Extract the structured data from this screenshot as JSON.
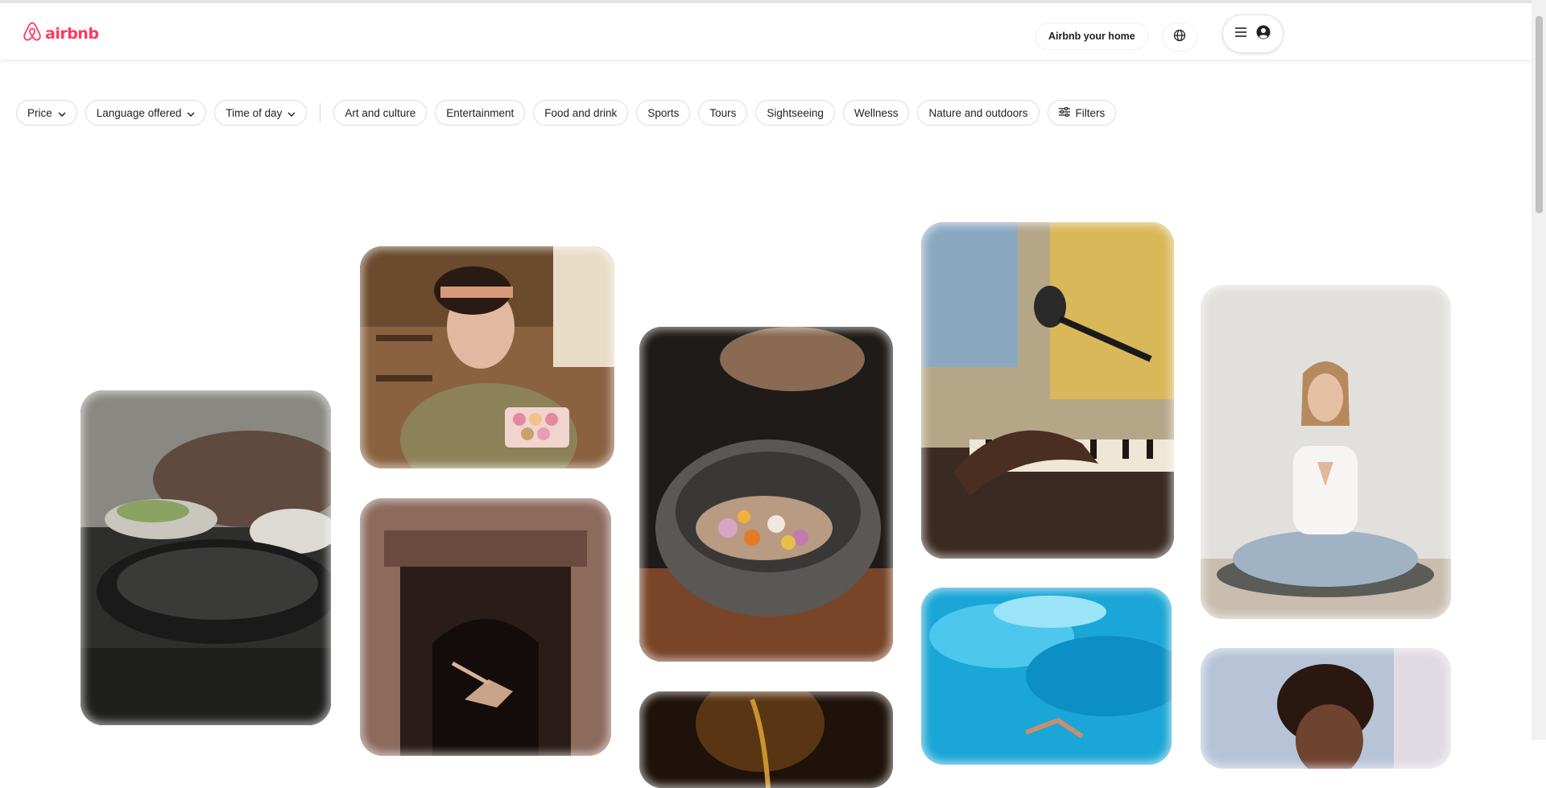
{
  "header": {
    "logo_text": "airbnb",
    "logo_icon": "airbnb-belo-icon",
    "host_label": "Airbnb your home",
    "globe_icon": "globe-icon",
    "menu_icon": "hamburger-menu-icon",
    "user_icon": "user-avatar-icon"
  },
  "filters": {
    "dropdowns": [
      {
        "label": "Price",
        "icon": "chevron-down-icon"
      },
      {
        "label": "Language offered",
        "icon": "chevron-down-icon"
      },
      {
        "label": "Time of day",
        "icon": "chevron-down-icon"
      }
    ],
    "categories": [
      "Art and culture",
      "Entertainment",
      "Food and drink",
      "Sports",
      "Tours",
      "Sightseeing",
      "Wellness",
      "Nature and outdoors"
    ],
    "filters_label": "Filters",
    "filters_icon": "sliders-icon"
  },
  "tiles": [
    {
      "subject": "cooking-class-photo",
      "colors": [
        "#3b3b38",
        "#7a7a72",
        "#c9c5bd"
      ]
    },
    {
      "subject": "baker-with-macarons-photo",
      "colors": [
        "#6b4a2e",
        "#b07c4f",
        "#e2c9a5"
      ]
    },
    {
      "subject": "dancer-in-doorway-photo",
      "colors": [
        "#5a3a30",
        "#8c6a5c",
        "#2a1c18"
      ]
    },
    {
      "subject": "stone-bowl-seasoning-photo",
      "colors": [
        "#2e2a27",
        "#6e6a66",
        "#8a5a3c"
      ]
    },
    {
      "subject": "dark-bottom-photo",
      "colors": [
        "#1e120a",
        "#5a3514",
        "#9a6a2a"
      ]
    },
    {
      "subject": "piano-microphone-photo",
      "colors": [
        "#c9a55a",
        "#8aa8c0",
        "#3b2a22"
      ]
    },
    {
      "subject": "swimming-pool-photo",
      "colors": [
        "#0fa8d8",
        "#1bc0ea",
        "#5ad8f5"
      ]
    },
    {
      "subject": "yoga-meditation-photo",
      "colors": [
        "#e8e6e3",
        "#d8d5d0",
        "#8fa6b8"
      ]
    },
    {
      "subject": "singer-portrait-photo",
      "colors": [
        "#b7c4d8",
        "#3a2418",
        "#d9d5e0"
      ]
    }
  ]
}
